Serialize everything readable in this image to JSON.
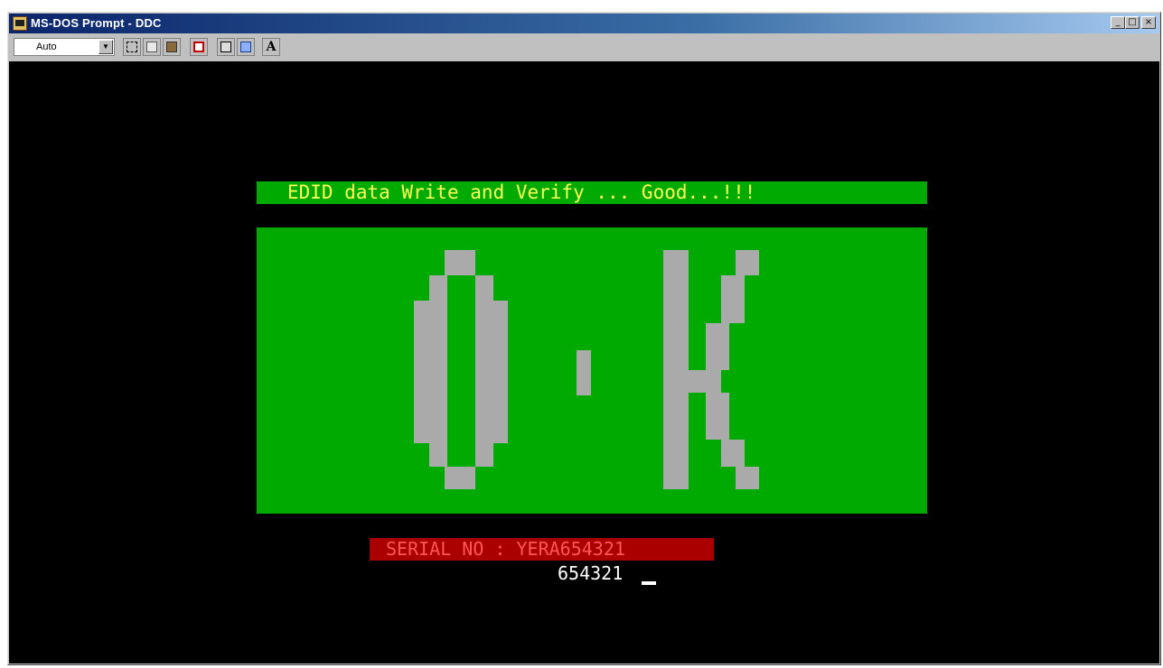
{
  "window": {
    "title": "MS-DOS Prompt - DDC",
    "controls": {
      "minimize": "_",
      "maximize": "□",
      "close": "×"
    }
  },
  "toolbar": {
    "font_size": "Auto",
    "buttons": [
      {
        "icon": "mark-icon"
      },
      {
        "icon": "copy-icon"
      },
      {
        "icon": "paste-icon"
      },
      {
        "icon": "fullscreen-icon"
      },
      {
        "icon": "properties-icon"
      },
      {
        "icon": "background-icon"
      },
      {
        "icon": "font-icon",
        "label": "A"
      }
    ]
  },
  "console": {
    "status_message": "EDID data Write and Verify ... Good...!!!",
    "result_big_text": "O.K",
    "serial_label": "SERIAL NO : YERA654321",
    "serial_input": "654321",
    "colors": {
      "background": "#000000",
      "panel_green": "#00aa00",
      "status_yellow": "#ffff55",
      "big_text_gray": "#aaaaaa",
      "serial_red_bg": "#aa0000",
      "serial_red_text": "#ff5555"
    }
  }
}
